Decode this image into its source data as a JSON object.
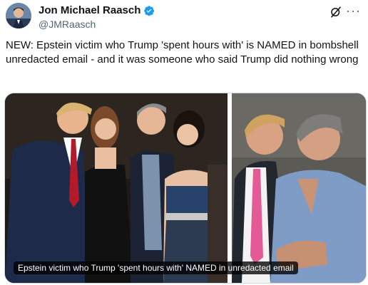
{
  "author": {
    "name": "Jon Michael Raasch",
    "handle": "@JMRaasch",
    "verified": true,
    "avatar_icon": "avatar-photo"
  },
  "actions": {
    "grok_icon": "grok-icon",
    "more_icon": "more-icon",
    "more_label": "···"
  },
  "tweet": {
    "text": "NEW: Epstein victim who Trump 'spent hours with' is NAMED in bombshell unredacted email - and it was someone who said Trump did nothing wrong"
  },
  "media": {
    "caption": "Epstein victim who Trump 'spent hours with' NAMED in unredacted email"
  },
  "colors": {
    "verified_blue": "#1d9bf0",
    "text_primary": "#0f1419",
    "text_secondary": "#536471"
  }
}
